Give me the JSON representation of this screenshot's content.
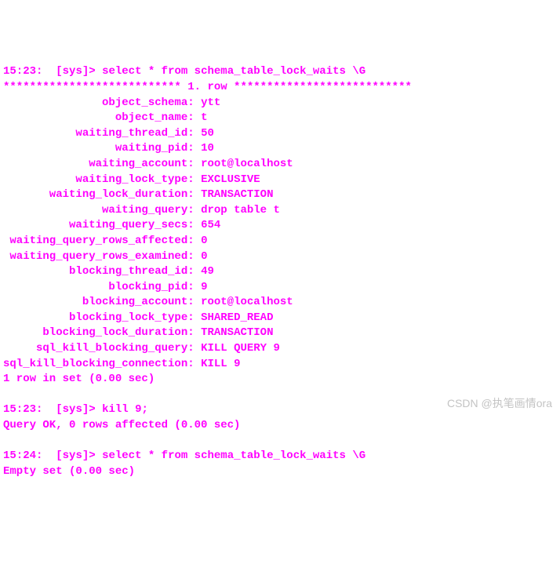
{
  "prompt1": {
    "time": "15:23:",
    "context": "[sys]>",
    "cmd": "select * from schema_table_lock_waits \\G"
  },
  "separator": "*************************** 1. row ***************************",
  "rows": [
    {
      "label": "object_schema",
      "value": "ytt"
    },
    {
      "label": "object_name",
      "value": "t"
    },
    {
      "label": "waiting_thread_id",
      "value": "50"
    },
    {
      "label": "waiting_pid",
      "value": "10"
    },
    {
      "label": "waiting_account",
      "value": "root@localhost"
    },
    {
      "label": "waiting_lock_type",
      "value": "EXCLUSIVE"
    },
    {
      "label": "waiting_lock_duration",
      "value": "TRANSACTION"
    },
    {
      "label": "waiting_query",
      "value": "drop table t"
    },
    {
      "label": "waiting_query_secs",
      "value": "654"
    },
    {
      "label": "waiting_query_rows_affected",
      "value": "0"
    },
    {
      "label": "waiting_query_rows_examined",
      "value": "0"
    },
    {
      "label": "blocking_thread_id",
      "value": "49"
    },
    {
      "label": "blocking_pid",
      "value": "9"
    },
    {
      "label": "blocking_account",
      "value": "root@localhost"
    },
    {
      "label": "blocking_lock_type",
      "value": "SHARED_READ"
    },
    {
      "label": "blocking_lock_duration",
      "value": "TRANSACTION"
    },
    {
      "label": "sql_kill_blocking_query",
      "value": "KILL QUERY 9"
    },
    {
      "label": "sql_kill_blocking_connection",
      "value": "KILL 9"
    }
  ],
  "result1": "1 row in set (0.00 sec)",
  "prompt2": {
    "time": "15:23:",
    "context": "[sys]>",
    "cmd": "kill 9;"
  },
  "result2": "Query OK, 0 rows affected (0.00 sec)",
  "prompt3": {
    "time": "15:24:",
    "context": "[sys]>",
    "cmd": "select * from schema_table_lock_waits \\G"
  },
  "result3": "Empty set (0.00 sec)",
  "watermark": "CSDN @执笔画情ora",
  "label_width": 28
}
